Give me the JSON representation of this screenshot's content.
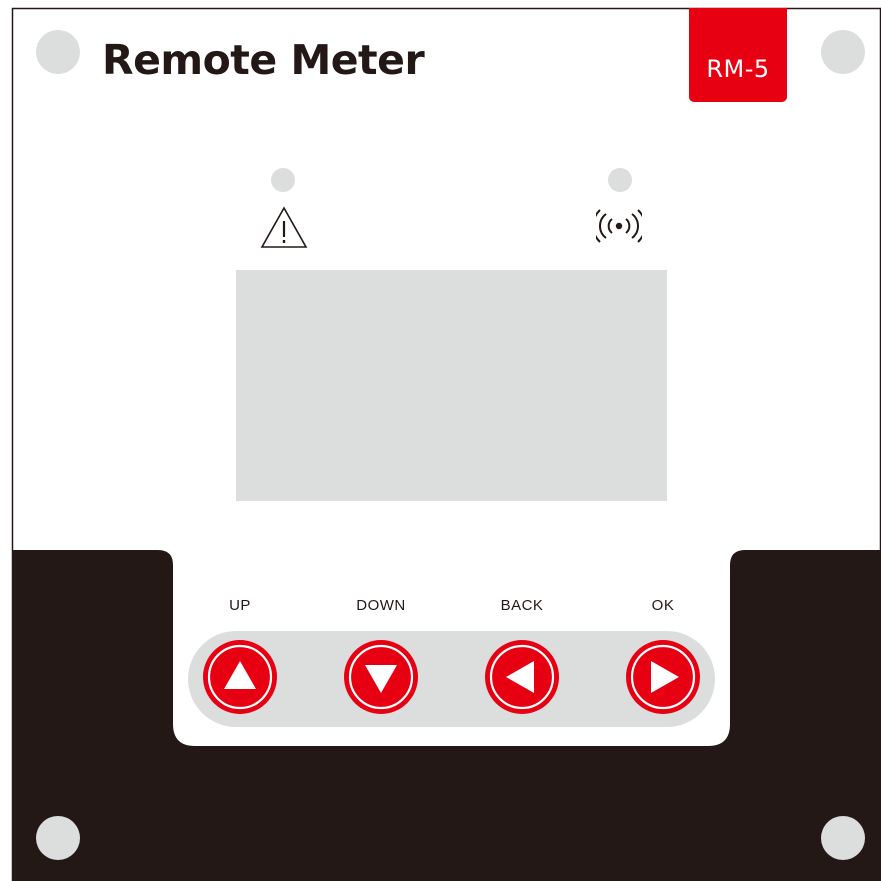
{
  "header": {
    "title": "Remote Meter",
    "model": "RM-5"
  },
  "indicators": [
    {
      "icon": "warning-icon"
    },
    {
      "icon": "wireless-signal-icon"
    }
  ],
  "buttons": [
    {
      "label": "UP",
      "icon": "arrow-up-icon"
    },
    {
      "label": "DOWN",
      "icon": "arrow-down-icon"
    },
    {
      "label": "BACK",
      "icon": "arrow-left-icon"
    },
    {
      "label": "OK",
      "icon": "arrow-right-icon"
    }
  ],
  "colors": {
    "panel_dark": "#231815",
    "accent_red": "#e60012",
    "display_gray": "#dcdddd",
    "screw_gray": "#dcdddd"
  }
}
